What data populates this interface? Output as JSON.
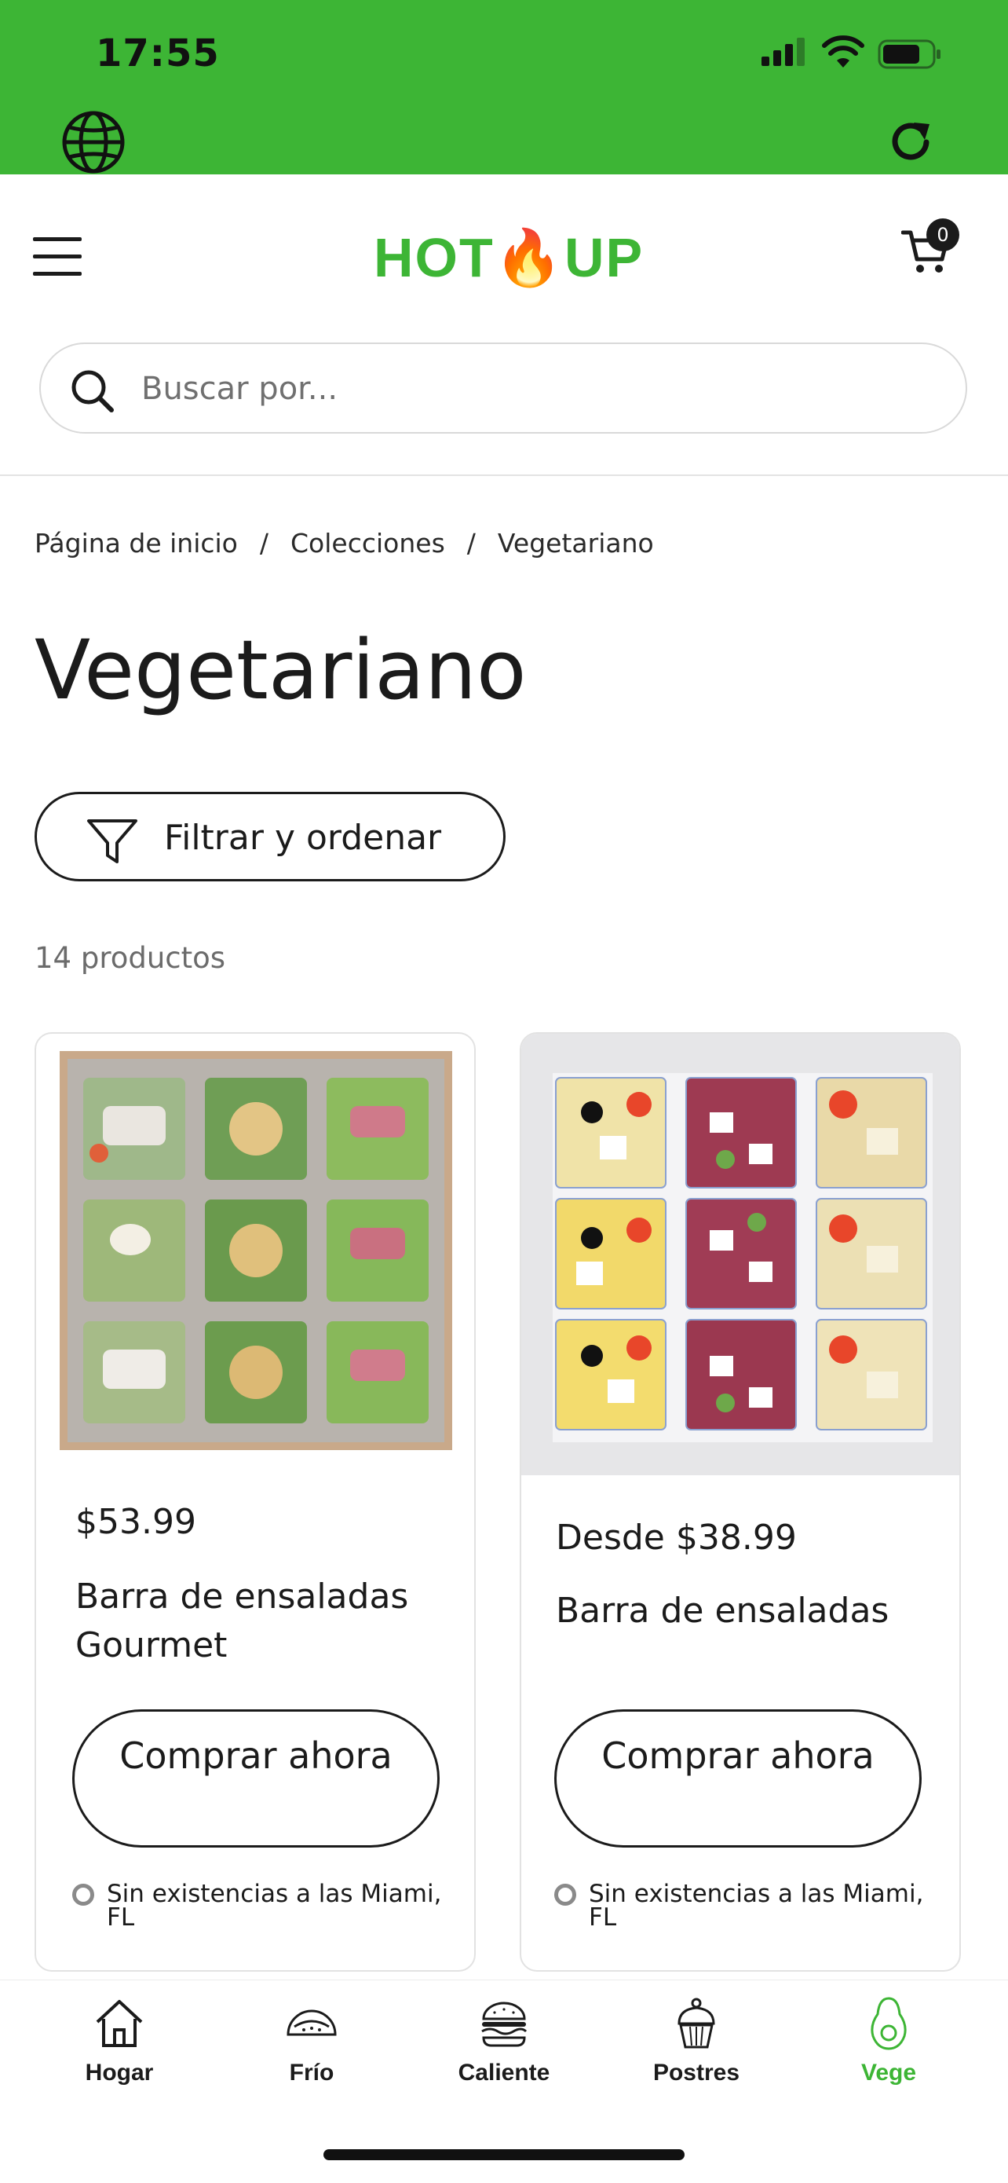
{
  "status_bar": {
    "time": "17:55"
  },
  "header": {
    "logo_left": "HOT",
    "logo_right": "UP",
    "cart_count": "0"
  },
  "search": {
    "placeholder": "Buscar por..."
  },
  "breadcrumb": [
    "Página de inicio",
    "Colecciones",
    "Vegetariano"
  ],
  "page_title": "Vegetariano",
  "filter_label": "Filtrar y ordenar",
  "product_count": "14 productos",
  "products": [
    {
      "price": "$53.99",
      "name": "Barra de ensaladas Gourmet",
      "button": "Comprar ahora",
      "stock": "Sin existencias a las Miami, FL"
    },
    {
      "price": "Desde $38.99",
      "name": "Barra de ensaladas",
      "button": "Comprar ahora",
      "stock": "Sin existencias a las Miami, FL"
    }
  ],
  "tabs": [
    {
      "label": "Hogar",
      "icon": "home-icon"
    },
    {
      "label": "Frío",
      "icon": "taco-icon"
    },
    {
      "label": "Caliente",
      "icon": "burger-icon"
    },
    {
      "label": "Postres",
      "icon": "cupcake-icon"
    },
    {
      "label": "Vege",
      "icon": "avocado-icon",
      "active": true
    }
  ],
  "colors": {
    "brand_green": "#3db535",
    "flame_red": "#e8321e",
    "text": "#1b1b1b"
  }
}
